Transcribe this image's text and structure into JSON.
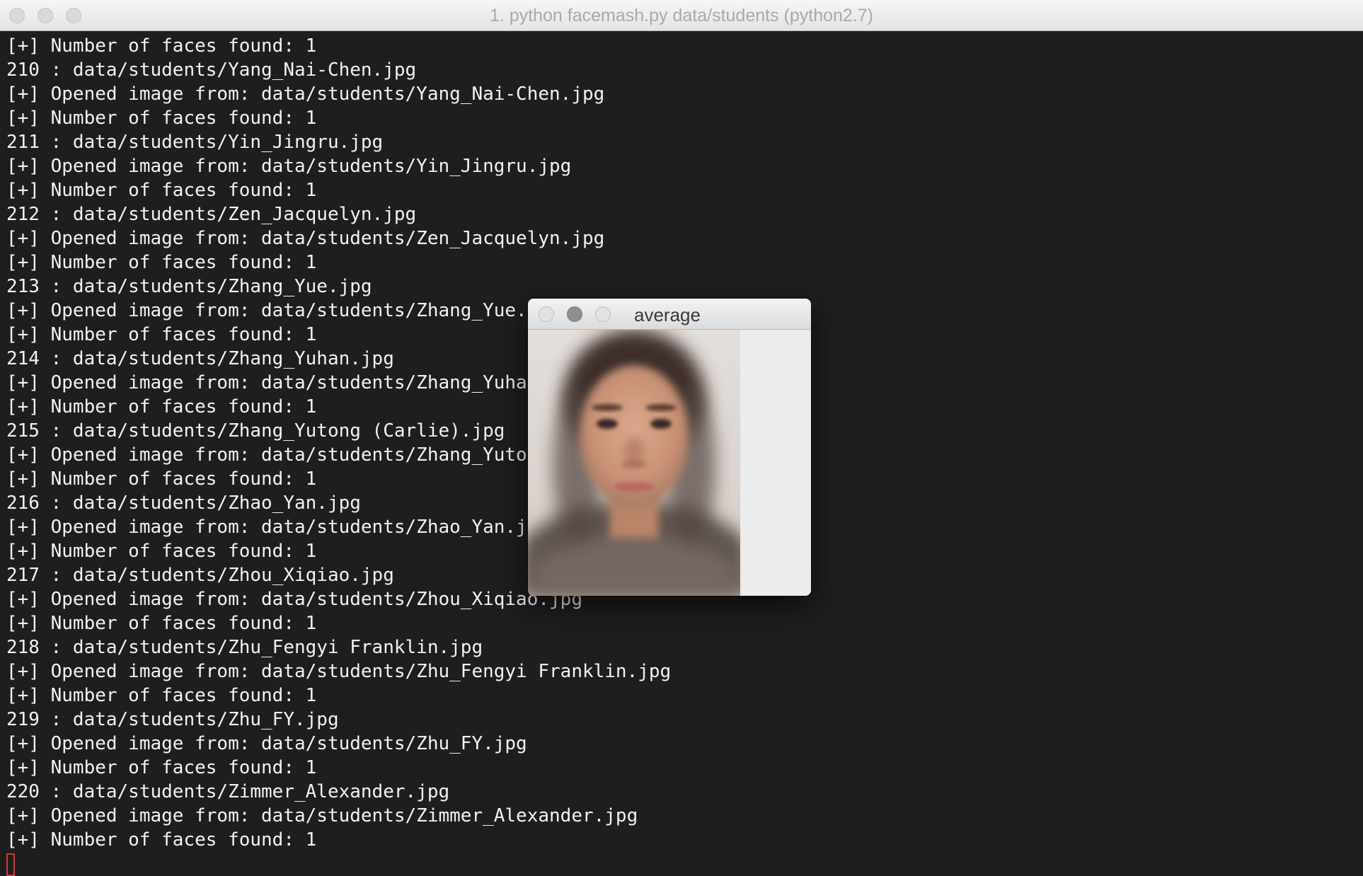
{
  "terminal": {
    "title": "1. python facemash.py data/students (python2.7)",
    "lines": [
      "[+] Number of faces found: 1",
      "210 : data/students/Yang_Nai-Chen.jpg",
      "[+] Opened image from: data/students/Yang_Nai-Chen.jpg",
      "[+] Number of faces found: 1",
      "211 : data/students/Yin_Jingru.jpg",
      "[+] Opened image from: data/students/Yin_Jingru.jpg",
      "[+] Number of faces found: 1",
      "212 : data/students/Zen_Jacquelyn.jpg",
      "[+] Opened image from: data/students/Zen_Jacquelyn.jpg",
      "[+] Number of faces found: 1",
      "213 : data/students/Zhang_Yue.jpg",
      "[+] Opened image from: data/students/Zhang_Yue.jpg",
      "[+] Number of faces found: 1",
      "214 : data/students/Zhang_Yuhan.jpg",
      "[+] Opened image from: data/students/Zhang_Yuhan.jpg",
      "[+] Number of faces found: 1",
      "215 : data/students/Zhang_Yutong (Carlie).jpg",
      "[+] Opened image from: data/students/Zhang_Yutong (Carlie).jpg",
      "[+] Number of faces found: 1",
      "216 : data/students/Zhao_Yan.jpg",
      "[+] Opened image from: data/students/Zhao_Yan.jpg",
      "[+] Number of faces found: 1",
      "217 : data/students/Zhou_Xiqiao.jpg",
      "[+] Opened image from: data/students/Zhou_Xiqiao.jpg",
      "[+] Number of faces found: 1",
      "218 : data/students/Zhu_Fengyi Franklin.jpg",
      "[+] Opened image from: data/students/Zhu_Fengyi Franklin.jpg",
      "[+] Number of faces found: 1",
      "219 : data/students/Zhu_FY.jpg",
      "[+] Opened image from: data/students/Zhu_FY.jpg",
      "[+] Number of faces found: 1",
      "220 : data/students/Zimmer_Alexander.jpg",
      "[+] Opened image from: data/students/Zimmer_Alexander.jpg",
      "[+] Number of faces found: 1"
    ]
  },
  "image_window": {
    "title": "average",
    "image_icon": "averaged-face-image"
  },
  "colors": {
    "terminal_background": "#1e1e1e",
    "terminal_text": "#f2f2f2",
    "cursor": "#d23a3a"
  }
}
